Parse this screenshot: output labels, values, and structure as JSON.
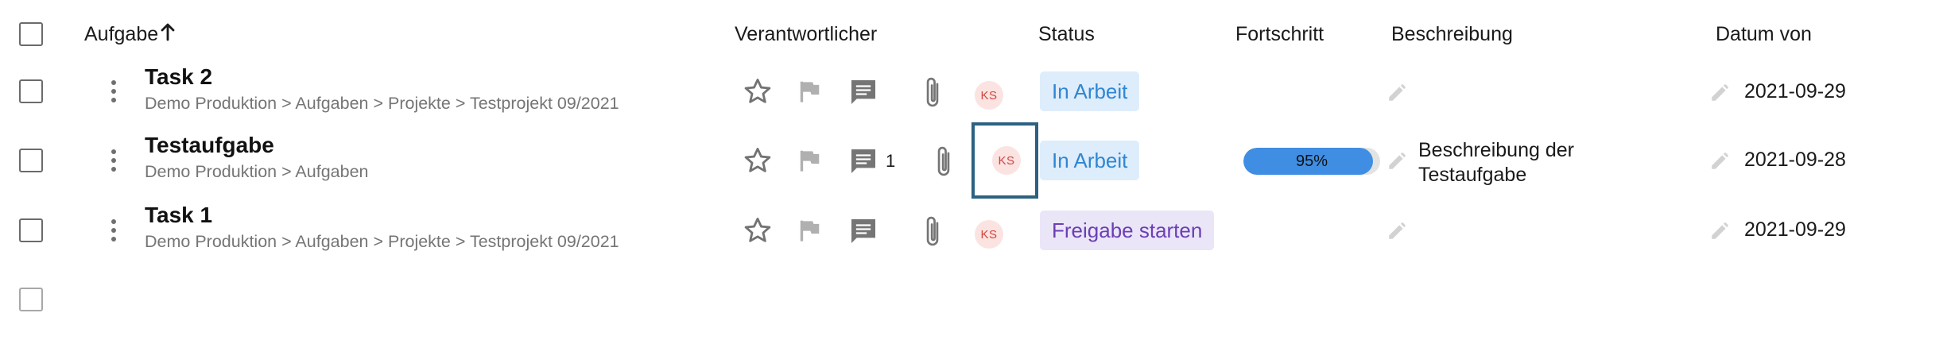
{
  "header": {
    "task_label": "Aufgabe",
    "sort_icon": "arrow-up-icon",
    "owner_label": "Verantwortlicher",
    "status_label": "Status",
    "progress_label": "Fortschritt",
    "description_label": "Beschreibung",
    "date_label": "Datum von"
  },
  "rows": [
    {
      "title": "Task 2",
      "breadcrumb": "Demo Produktion > Aufgaben > Projekte > Testprojekt 09/2021",
      "comment_count": "",
      "avatar": "KS",
      "status": "In Arbeit",
      "status_color": "#2f86d3",
      "progress": "",
      "description": "",
      "date": "2021-09-29"
    },
    {
      "title": "Testaufgabe",
      "breadcrumb": "Demo Produktion > Aufgaben",
      "comment_count": "1",
      "avatar": "KS",
      "status": "In Arbeit",
      "status_color": "#2f86d3",
      "progress": "95%",
      "progress_value": 0.95,
      "description": "Beschreibung der Testaufgabe",
      "date": "2021-09-28"
    },
    {
      "title": "Task 1",
      "breadcrumb": "Demo Produktion > Aufgaben > Projekte > Testprojekt 09/2021",
      "comment_count": "",
      "avatar": "KS",
      "status": "Freigabe starten",
      "status_color": "#6a3fb3",
      "progress": "",
      "description": "",
      "date": "2021-09-29"
    }
  ],
  "icons": {
    "more": "more-vertical-icon",
    "favorite": "star-icon",
    "flag": "flag-icon",
    "comments": "comment-icon",
    "attachment": "paperclip-icon",
    "edit": "pencil-icon"
  }
}
